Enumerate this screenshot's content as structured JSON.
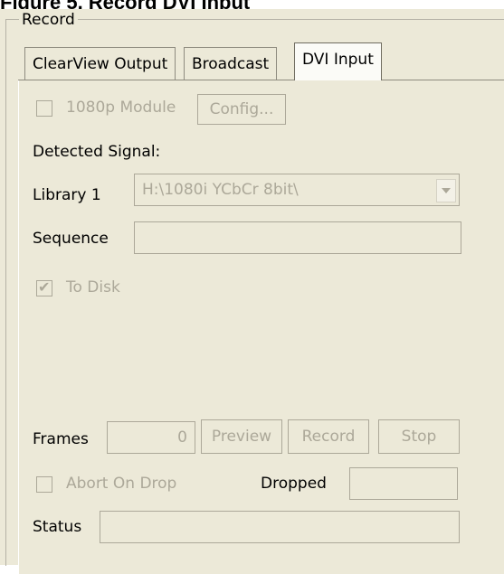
{
  "caption": "Figure 5. Record DVI Input",
  "group": {
    "title": "Record"
  },
  "tabs": [
    {
      "label": "ClearView Output",
      "active": false
    },
    {
      "label": "Broadcast",
      "active": false
    },
    {
      "label": "DVI Input",
      "active": true
    }
  ],
  "module": {
    "checkbox_label": "1080p Module",
    "checked": false,
    "config_button": "Config..."
  },
  "detected_signal_label": "Detected Signal:",
  "library": {
    "label": "Library 1",
    "value": "H:\\1080i YCbCr 8bit\\"
  },
  "sequence": {
    "label": "Sequence",
    "value": ""
  },
  "to_disk": {
    "label": "To Disk",
    "checked": true
  },
  "frames": {
    "label": "Frames",
    "value": "0"
  },
  "buttons": {
    "preview": "Preview",
    "record": "Record",
    "stop": "Stop"
  },
  "abort_on_drop": {
    "label": "Abort On Drop",
    "checked": false
  },
  "dropped": {
    "label": "Dropped",
    "value": ""
  },
  "status": {
    "label": "Status",
    "value": ""
  },
  "colors": {
    "panel_bg": "#ece9d8",
    "disabled_text": "#aca899"
  }
}
